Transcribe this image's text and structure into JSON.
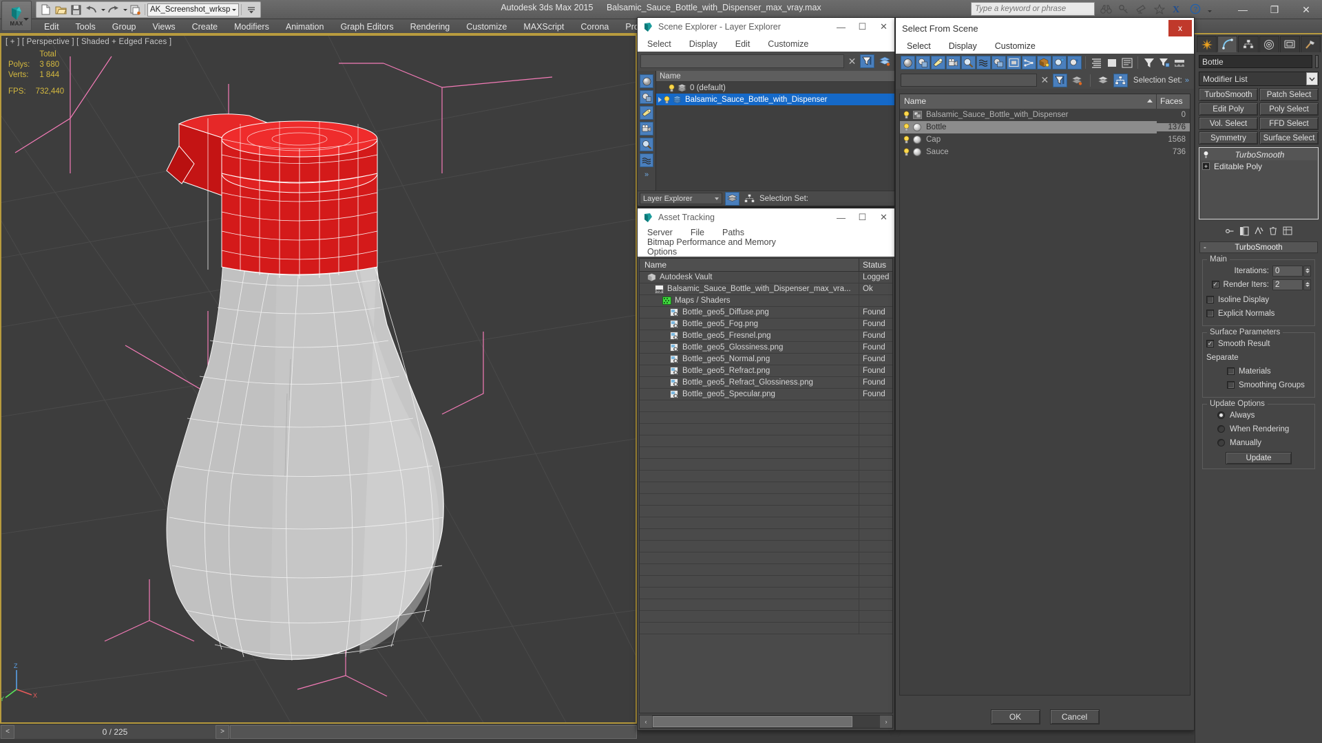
{
  "app": {
    "title_product": "Autodesk 3ds Max  2015",
    "title_file": "Balsamic_Sauce_Bottle_with_Dispenser_max_vray.max",
    "workspace": "AK_Screenshot_wrksp",
    "max_logo_label": "MAX"
  },
  "search": {
    "placeholder": "Type a keyword or phrase",
    "value": ""
  },
  "menubar": {
    "items": [
      "Edit",
      "Tools",
      "Group",
      "Views",
      "Create",
      "Modifiers",
      "Animation",
      "Graph Editors",
      "Rendering",
      "Customize",
      "MAXScript",
      "Corona",
      "Project Man"
    ]
  },
  "quick_access": {
    "icons": [
      "new-icon",
      "open-icon",
      "save-icon",
      "undo-icon",
      "redo-icon",
      "set-project-icon"
    ]
  },
  "titlebar_icons": [
    "binoculars-icon",
    "key-icon",
    "satellite-icon",
    "star-icon",
    "x-logo-icon",
    "help-icon"
  ],
  "window_controls": {
    "minimize": "—",
    "maximize": "❐",
    "close": "✕"
  },
  "viewport": {
    "label": "[ + ] [ Perspective ] [ Shaded + Edged Faces ]",
    "stats": {
      "total_header": "Total",
      "polys_label": "Polys:",
      "polys_value": "3 680",
      "verts_label": "Verts:",
      "verts_value": "1 844",
      "fps_label": "FPS:",
      "fps_value": "732,440"
    }
  },
  "timeline": {
    "prev": "<",
    "frame": "0 / 225",
    "next": ">"
  },
  "scene_explorer": {
    "title": "Scene Explorer - Layer Explorer",
    "menu": [
      "Select",
      "Display",
      "Edit",
      "Customize"
    ],
    "search_value": "",
    "clear_label": "✕",
    "column_name": "Name",
    "rows": [
      {
        "name": "0 (default)",
        "selected": false,
        "expandable": false
      },
      {
        "name": "Balsamic_Sauce_Bottle_with_Dispenser",
        "selected": true,
        "expandable": true
      }
    ],
    "footer": {
      "mode": "Layer Explorer",
      "selection_set_label": "Selection Set:"
    },
    "rail_icons": [
      "geometry-icon",
      "shapes-icon",
      "lights-icon",
      "cameras-icon",
      "helpers-icon",
      "spacewarps-icon",
      "more-icon"
    ]
  },
  "asset_tracking": {
    "title": "Asset Tracking",
    "menu": [
      "Server",
      "File",
      "Paths",
      "Bitmap Performance and Memory",
      "Options"
    ],
    "toolbar_icons": [
      "refresh-icon",
      "list-view-icon",
      "detail-view-icon",
      "grid-view-icon",
      "help-new-icon",
      "help-icon"
    ],
    "columns": {
      "name": "Name",
      "status": "Status"
    },
    "rows": [
      {
        "name": "Autodesk Vault",
        "status": "Logged",
        "indent": 1,
        "icon": "vault-icon"
      },
      {
        "name": "Balsamic_Sauce_Bottle_with_Dispenser_max_vra...",
        "status": "Ok",
        "indent": 2,
        "icon": "max-file-icon"
      },
      {
        "name": "Maps / Shaders",
        "status": "",
        "indent": 3,
        "icon": "maps-icon"
      },
      {
        "name": "Bottle_geo5_Diffuse.png",
        "status": "Found",
        "indent": 4,
        "icon": "bitmap-icon"
      },
      {
        "name": "Bottle_geo5_Fog.png",
        "status": "Found",
        "indent": 4,
        "icon": "bitmap-icon"
      },
      {
        "name": "Bottle_geo5_Fresnel.png",
        "status": "Found",
        "indent": 4,
        "icon": "bitmap-icon"
      },
      {
        "name": "Bottle_geo5_Glossiness.png",
        "status": "Found",
        "indent": 4,
        "icon": "bitmap-icon"
      },
      {
        "name": "Bottle_geo5_Normal.png",
        "status": "Found",
        "indent": 4,
        "icon": "bitmap-icon"
      },
      {
        "name": "Bottle_geo5_Refract.png",
        "status": "Found",
        "indent": 4,
        "icon": "bitmap-icon"
      },
      {
        "name": "Bottle_geo5_Refract_Glossiness.png",
        "status": "Found",
        "indent": 4,
        "icon": "bitmap-icon"
      },
      {
        "name": "Bottle_geo5_Specular.png",
        "status": "Found",
        "indent": 4,
        "icon": "bitmap-icon"
      }
    ],
    "empty_row_count": 20,
    "scroll": {
      "left": "‹",
      "right": "›"
    }
  },
  "select_from_scene": {
    "title": "Select From Scene",
    "close_label": "x",
    "menu": [
      "Select",
      "Display",
      "Customize"
    ],
    "filter_icons": [
      "geometry-icon",
      "shapes-icon",
      "lights-icon",
      "cameras-icon",
      "helpers-icon",
      "spacewarps-icon",
      "groups-icon",
      "xrefs-icon",
      "bones-icon",
      "containers-icon",
      "particles-icon",
      "frozen-icon"
    ],
    "view_icons": [
      "expand-all-icon",
      "collapse-all-icon",
      "list-types-icon",
      "filter-icon",
      "filter-selected-icon",
      "display-children-icon"
    ],
    "search_value": "",
    "clear_label": "✕",
    "toolbar2_icons": [
      "filter-toggle-icon",
      "layers-icon",
      "layer-stack-icon",
      "hierarchy-icon"
    ],
    "selection_set_label": "Selection Set:",
    "columns": {
      "name": "Name",
      "faces": "Faces"
    },
    "rows": [
      {
        "name": "Balsamic_Sauce_Bottle_with_Dispenser",
        "faces": "0",
        "icon": "group-icon",
        "highlight": false
      },
      {
        "name": "Bottle",
        "faces": "1376",
        "icon": "geometry-icon",
        "highlight": true
      },
      {
        "name": "Cap",
        "faces": "1568",
        "icon": "geometry-icon",
        "highlight": false
      },
      {
        "name": "Sauce",
        "faces": "736",
        "icon": "geometry-icon",
        "highlight": false
      }
    ],
    "buttons": {
      "ok": "OK",
      "cancel": "Cancel"
    }
  },
  "command_panel": {
    "tabs": [
      "create-tab",
      "modify-tab",
      "hierarchy-tab",
      "motion-tab",
      "display-tab",
      "utilities-tab"
    ],
    "active_tab_index": 1,
    "object_name": "Bottle",
    "modifier_list_label": "Modifier List",
    "modifier_buttons": [
      "TurboSmooth",
      "Patch Select",
      "Edit Poly",
      "Poly Select",
      "Vol. Select",
      "FFD Select",
      "Symmetry",
      "Surface Select"
    ],
    "stack": [
      {
        "name": "TurboSmooth",
        "type": "modifier"
      },
      {
        "name": "Editable Poly",
        "type": "base"
      }
    ],
    "stack_tool_icons": [
      "pin-stack-icon",
      "show-end-result-icon",
      "make-unique-icon",
      "remove-modifier-icon",
      "configure-sets-icon"
    ],
    "rollout": {
      "title": "TurboSmooth",
      "collapse_glyph": "-",
      "groups": [
        {
          "label": "Main",
          "fields": [
            {
              "type": "spinner",
              "label": "Iterations:",
              "value": "0"
            },
            {
              "type": "checkbox_spinner",
              "label": "Render Iters:",
              "value": "2",
              "checked": true
            },
            {
              "type": "checkbox",
              "label": "Isoline Display",
              "checked": false
            },
            {
              "type": "checkbox",
              "label": "Explicit Normals",
              "checked": false
            }
          ]
        },
        {
          "label": "Surface Parameters",
          "fields": [
            {
              "type": "checkbox",
              "label": "Smooth Result",
              "checked": true
            },
            {
              "type": "text",
              "label": "Separate"
            },
            {
              "type": "checkbox_indent",
              "label": "Materials",
              "checked": false
            },
            {
              "type": "checkbox_indent",
              "label": "Smoothing Groups",
              "checked": false
            }
          ]
        },
        {
          "label": "Update Options",
          "fields": [
            {
              "type": "radio",
              "label": "Always",
              "checked": true
            },
            {
              "type": "radio",
              "label": "When Rendering",
              "checked": false
            },
            {
              "type": "radio",
              "label": "Manually",
              "checked": false
            },
            {
              "type": "button",
              "label": "Update"
            }
          ]
        }
      ]
    }
  },
  "colors": {
    "accent_gold": "#b89b3e",
    "selection_blue": "#1569c8",
    "viewport_bg": "#3d3d3d",
    "model_red": "#d41a1a",
    "model_grey": "#c9c9c9",
    "gizmo_pink": "#ff7fbf"
  }
}
